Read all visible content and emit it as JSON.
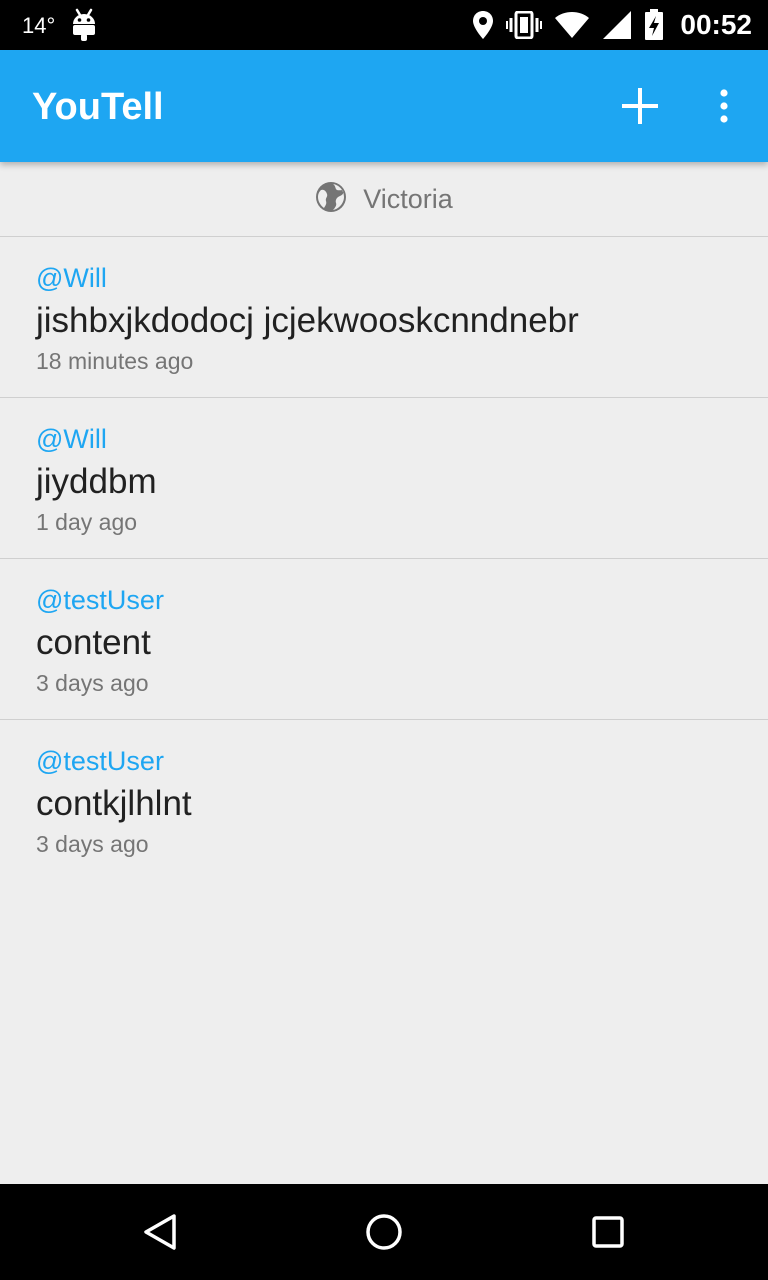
{
  "status_bar": {
    "temperature": "14°",
    "time": "00:52",
    "icons": [
      "android-icon",
      "location-icon",
      "vibrate-icon",
      "wifi-icon",
      "signal-icon",
      "battery-charging-icon"
    ]
  },
  "app_bar": {
    "title": "YouTell",
    "add_icon": "plus-icon",
    "menu_icon": "more-vert-icon",
    "color": "#1ea6f2"
  },
  "location": {
    "icon": "globe-icon",
    "label": "Victoria"
  },
  "feed": {
    "posts": [
      {
        "user": "@Will",
        "content": "jishbxjkdodocj jcjekwooskcnndnebr",
        "time": "18 minutes ago"
      },
      {
        "user": "@Will",
        "content": "jiyddbm",
        "time": "1 day ago"
      },
      {
        "user": "@testUser",
        "content": "content",
        "time": "3 days ago"
      },
      {
        "user": "@testUser",
        "content": "contkjlhlnt",
        "time": "3 days ago"
      }
    ]
  },
  "nav_bar": {
    "icons": [
      "back-icon",
      "home-icon",
      "recents-icon"
    ]
  }
}
